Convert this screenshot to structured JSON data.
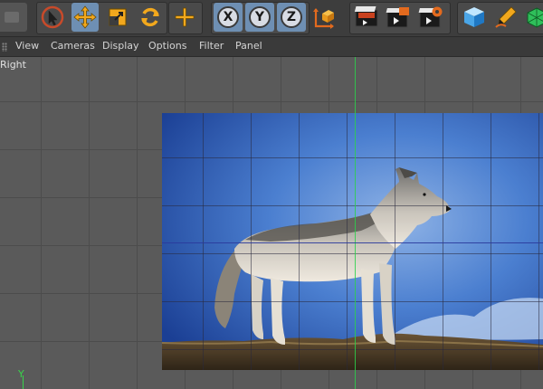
{
  "toolbar": {
    "buttons": [
      {
        "icon": "undo-placeholder-icon"
      },
      {
        "icon": "live-selection-icon"
      },
      {
        "icon": "move-icon"
      },
      {
        "icon": "scale-icon"
      },
      {
        "icon": "rotate-icon"
      },
      {
        "icon": "recent-tool-icon"
      },
      {
        "icon": "x-axis-icon",
        "label": "X"
      },
      {
        "icon": "y-axis-icon",
        "label": "Y"
      },
      {
        "icon": "z-axis-icon",
        "label": "Z"
      },
      {
        "icon": "coordinate-system-icon"
      },
      {
        "icon": "render-view-icon"
      },
      {
        "icon": "render-picture-viewer-icon"
      },
      {
        "icon": "render-settings-icon"
      },
      {
        "icon": "cube-icon"
      },
      {
        "icon": "pen-icon"
      },
      {
        "icon": "subdivision-icon"
      }
    ],
    "accent_color": "#f2a81d"
  },
  "menu": {
    "items": [
      "View",
      "Cameras",
      "Display",
      "Options",
      "Filter",
      "Panel"
    ]
  },
  "viewport": {
    "view_name": "Right",
    "axis_label": "Y",
    "axis_color_y": "#39d34b",
    "background_image": "wolf-photo"
  }
}
